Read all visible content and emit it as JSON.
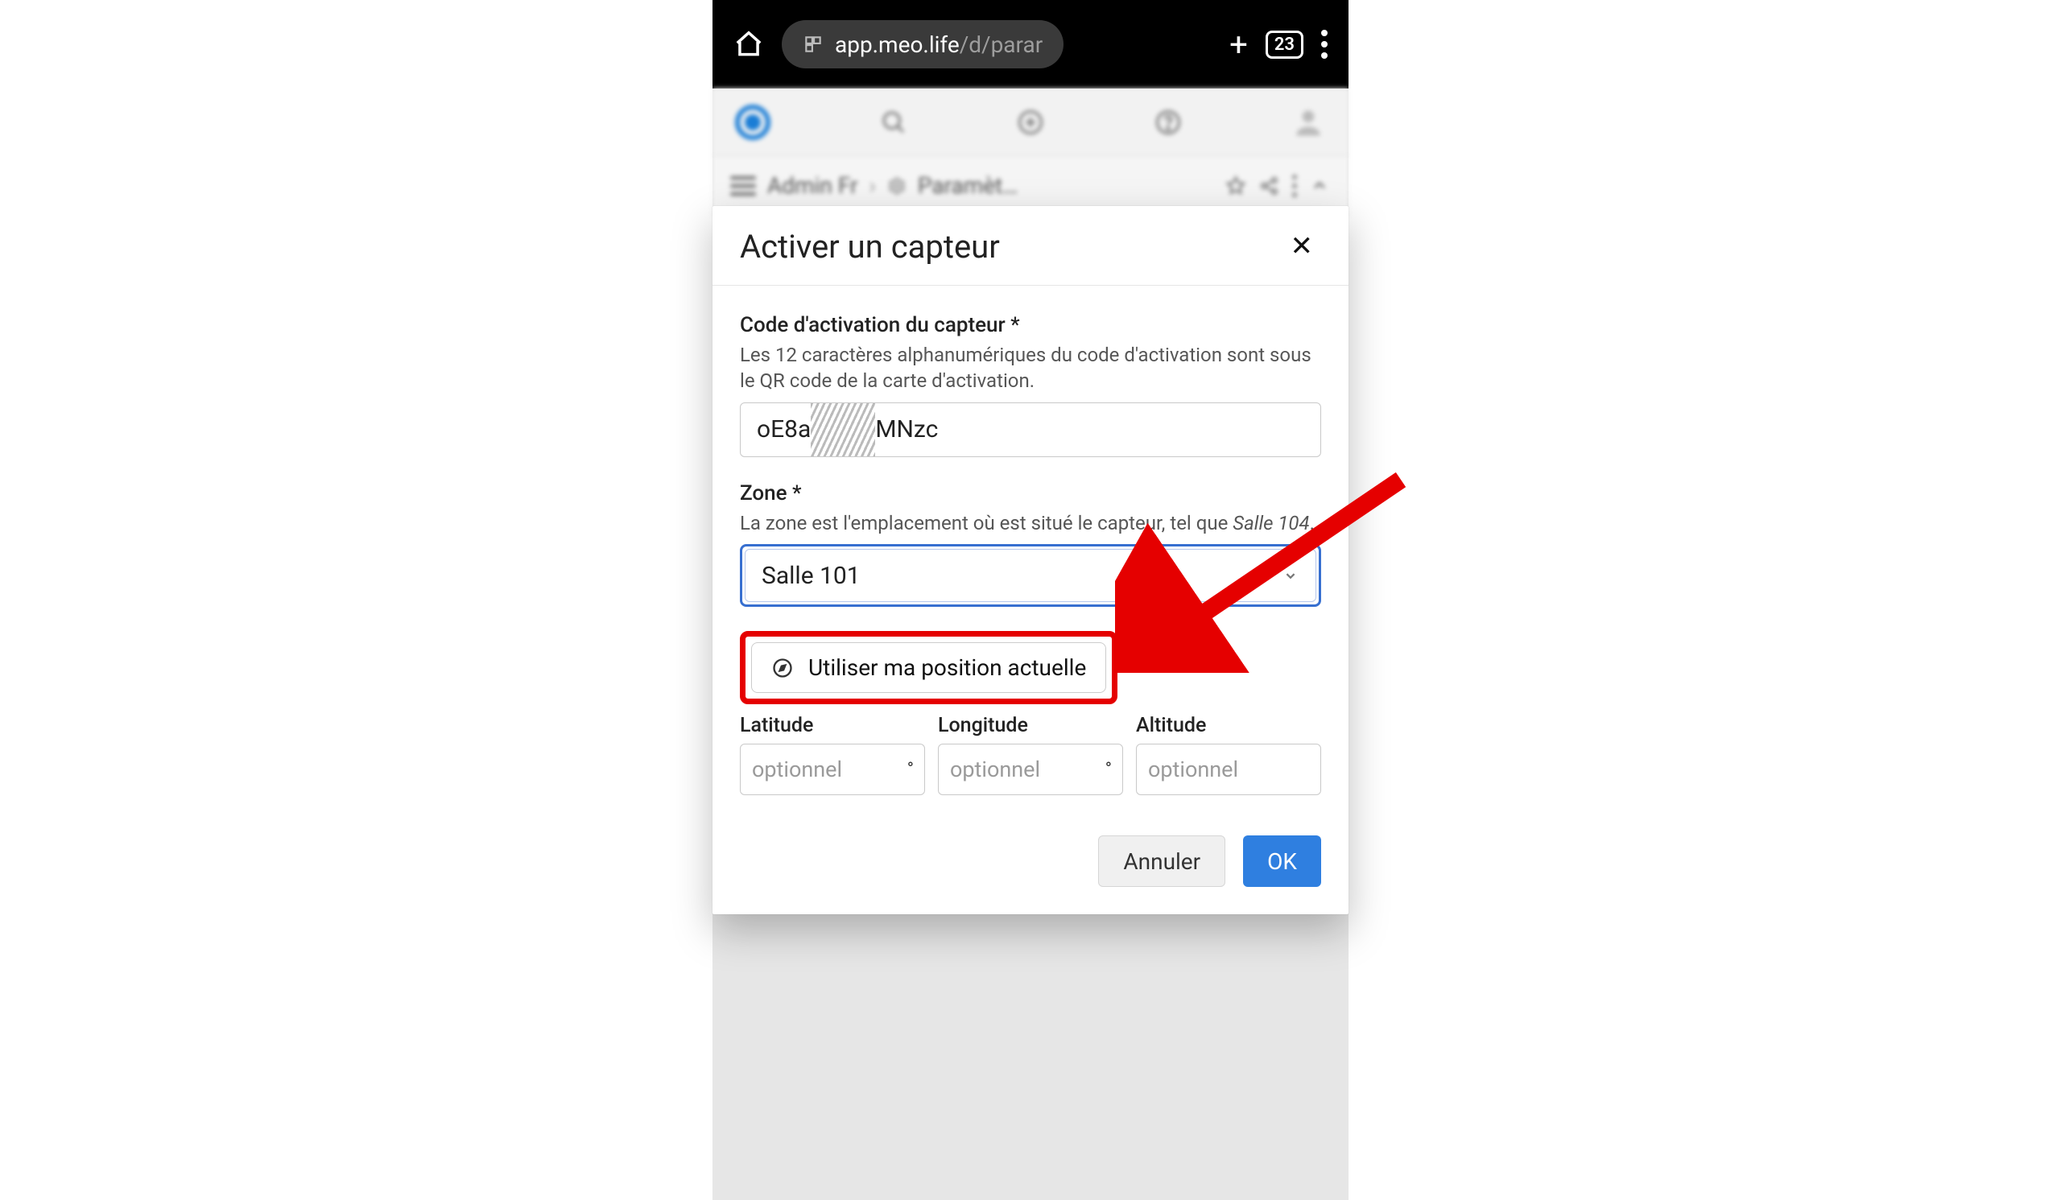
{
  "browser": {
    "url_domain": "app.meo.life",
    "url_path": "/d/parar",
    "tabs_count": "23"
  },
  "app": {
    "breadcrumb_root": "Admin Fr",
    "breadcrumb_page": "Paramèt…"
  },
  "dialog": {
    "title": "Activer un capteur",
    "code_label": "Code d'activation du capteur *",
    "code_help": "Les 12 caractères alphanumériques du code d'activation sont sous le QR code de la carte d'activation.",
    "code_before": "oE8a",
    "code_after": "MNzc",
    "zone_label": "Zone *",
    "zone_help_prefix": "La zone est l'emplacement où est situé le capteur, tel que ",
    "zone_help_example": "Salle 104",
    "zone_value": "Salle 101",
    "use_location_label": "Utiliser ma position actuelle",
    "latitude_label": "Latitude",
    "longitude_label": "Longitude",
    "altitude_label": "Altitude",
    "latitude_placeholder": "optionnel",
    "longitude_placeholder": "optionnel",
    "altitude_placeholder": "optionnel",
    "unit_degree": "°",
    "cancel_label": "Annuler",
    "ok_label": "OK"
  }
}
